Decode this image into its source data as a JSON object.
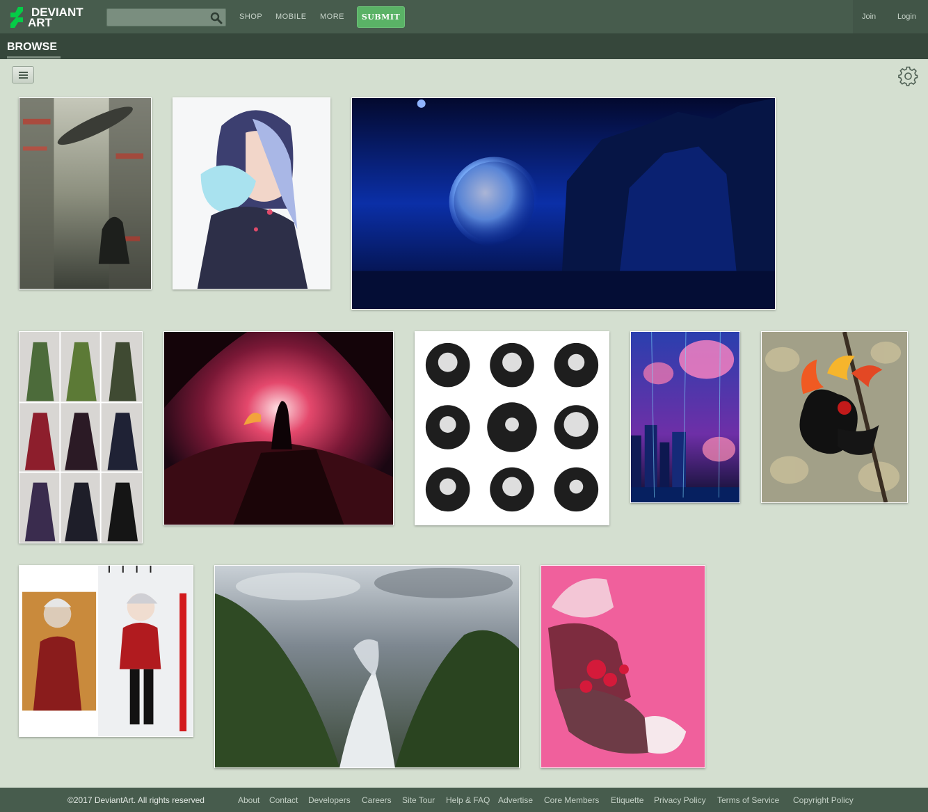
{
  "header": {
    "logo_line1": "DEVIANT",
    "logo_line2": "ART",
    "search": {
      "placeholder": ""
    },
    "nav": [
      {
        "label": "SHOP"
      },
      {
        "label": "MOBILE"
      },
      {
        "label": "MORE"
      }
    ],
    "submit_label": "SUBMIT",
    "join_label": "Join",
    "login_label": "Login"
  },
  "browse": {
    "title": "BROWSE"
  },
  "colors": {
    "topbar": "#475c4d",
    "browsebar": "#36473b",
    "page_background": "#d4dfd0",
    "submit_green": "#5ab266",
    "logo_green": "#05cc47"
  },
  "gallery": {
    "rows": [
      {
        "items": [
          {
            "subject": "city-whale-girl"
          },
          {
            "subject": "girl-with-owl"
          },
          {
            "subject": "blue-moon-castle"
          }
        ]
      },
      {
        "items": [
          {
            "subject": "gown-collection"
          },
          {
            "subject": "couple-sunset-cliff"
          },
          {
            "subject": "ink-portrait-grid"
          },
          {
            "subject": "jellyfish-city"
          },
          {
            "subject": "fire-bat-figure"
          }
        ]
      },
      {
        "items": [
          {
            "subject": "cosplay-sketch"
          },
          {
            "subject": "waterfall-mountains"
          },
          {
            "subject": "pink-cat-character"
          }
        ]
      }
    ]
  },
  "footer": {
    "copyright": "©2017 DeviantArt. All rights reserved",
    "links": [
      "About",
      "Contact",
      "Developers",
      "Careers",
      "Site Tour",
      "Help & FAQ",
      "Advertise",
      "Core Members",
      "Etiquette",
      "Privacy Policy",
      "Terms of Service",
      "Copyright Policy"
    ]
  }
}
